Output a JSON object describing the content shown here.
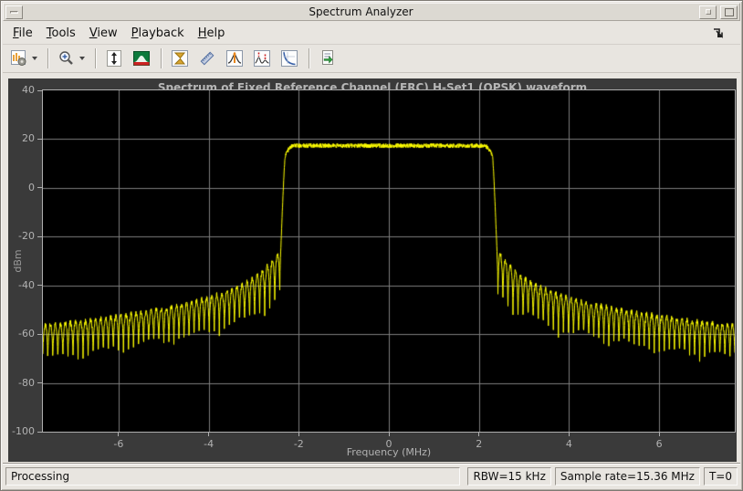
{
  "window": {
    "title": "Spectrum Analyzer"
  },
  "menu": {
    "items": [
      {
        "key": "F",
        "rest": "ile"
      },
      {
        "key": "T",
        "rest": "ools"
      },
      {
        "key": "V",
        "rest": "iew"
      },
      {
        "key": "P",
        "rest": "layback"
      },
      {
        "key": "H",
        "rest": "elp"
      }
    ]
  },
  "toolbar": {
    "buttons": [
      {
        "icon": "spectrum-settings-icon",
        "dropdown": true
      },
      {
        "icon": "zoom-in-icon",
        "dropdown": true
      },
      {
        "icon": "autoscale-y-axis-icon",
        "dropdown": false
      },
      {
        "icon": "spectrum-display-icon",
        "dropdown": false
      },
      {
        "icon": "cursor-measurements-icon",
        "dropdown": false
      },
      {
        "icon": "signal-measurements-icon",
        "dropdown": false
      },
      {
        "icon": "peak-finder-icon",
        "dropdown": false
      },
      {
        "icon": "distortion-measurements-icon",
        "dropdown": false
      },
      {
        "icon": "ccdf-measurements-icon",
        "dropdown": false
      },
      {
        "icon": "generate-script-icon",
        "dropdown": false
      }
    ]
  },
  "chart_data": {
    "type": "line",
    "title": "Spectrum of Fixed Reference Channel (FRC) H-Set1 (QPSK) waveform",
    "xlabel": "Frequency (MHz)",
    "ylabel": "dBm",
    "xlim": [
      -7.68,
      7.68
    ],
    "ylim": [
      -100,
      40
    ],
    "xticks": [
      -6,
      -4,
      -2,
      0,
      2,
      4,
      6
    ],
    "yticks": [
      40,
      20,
      0,
      -20,
      -40,
      -60,
      -80,
      -100
    ],
    "grid": true,
    "legend": "none",
    "line_color": "#ffff00",
    "plot_bg": "#000000",
    "axes_bg": "#3a3a3a",
    "grid_color": "#7d7d7d",
    "tick_color": "#b2b2b2",
    "series_description": "Power spectrum of QPSK FRC H-Set1 waveform: flat passband near 17.3 dBm from -2.2 to +2.2 MHz, steep roll-off at about +/-2.3 MHz, and a comb of sinc sidelobes whose peaks decay from about -26 dBm beside the transition to about -56 dBm at +/-7.68 MHz with valleys 17-22 dB deeper",
    "passband": {
      "level_dbm": 17.3,
      "ripple_db": 1.8,
      "flat_until_mhz": 2.1,
      "shoulder_drop_db": 4
    },
    "transition": {
      "edge_mhz": 2.3,
      "floor_mhz": 2.42,
      "floor_dbm": -36
    },
    "sidelobes": {
      "period_mhz": 0.112,
      "valley_depth_db_near": 22,
      "valley_depth_db_far": 17,
      "peak_envelope": [
        [
          2.42,
          -26
        ],
        [
          2.6,
          -30
        ],
        [
          2.8,
          -34
        ],
        [
          3.0,
          -37
        ],
        [
          3.3,
          -40
        ],
        [
          3.6,
          -42.5
        ],
        [
          4.0,
          -45
        ],
        [
          4.5,
          -47.5
        ],
        [
          5.0,
          -49.5
        ],
        [
          5.5,
          -51
        ],
        [
          6.0,
          -52.5
        ],
        [
          6.5,
          -54
        ],
        [
          7.0,
          -55
        ],
        [
          7.68,
          -56.5
        ]
      ]
    }
  },
  "status_bar": {
    "processing": "Processing",
    "rbw": "RBW=15 kHz",
    "sample_rate": "Sample rate=15.36 MHz",
    "time": "T=0"
  }
}
